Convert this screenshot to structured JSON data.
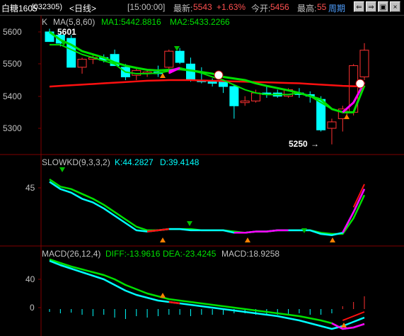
{
  "header": {
    "symbol": "白糖1605",
    "code": "(032305)",
    "period": "<日线>",
    "time": "[15:00:00]",
    "latest_label": "最新:",
    "latest_value": "5543",
    "change": "+1.63%",
    "open_label": "今开:",
    "open_value": "5456",
    "high_label": "最高:",
    "high_value": "55",
    "cycle_label": "周期"
  },
  "colors": {
    "up": "#ff3232",
    "down": "#00ffff",
    "green_line": "#00e000",
    "red_line": "#ff1010",
    "magenta": "#ff00ff",
    "cyan": "#00ffff",
    "text_axis": "#c0c0c0",
    "grid": "#800000"
  },
  "price_panel": {
    "title": "K",
    "ma_label": "MA(5,8,60)",
    "ma1": "MA1:5442.8816",
    "ma2": "MA2:5433.2266",
    "high_marker": "5601",
    "low_marker": "5250",
    "y_ticks": [
      "5600",
      "5500",
      "5400",
      "5300"
    ]
  },
  "kd_panel": {
    "title": "SLOWKD(9,3,3,2)",
    "k": "K:44.2827",
    "d": "D:39.4148",
    "y_ticks": [
      "45"
    ]
  },
  "macd_panel": {
    "title": "MACD(26,12,4)",
    "diff": "DIFF:-13.9616",
    "dea": "DEA:-23.4245",
    "macd": "MACD:18.9258",
    "y_ticks": [
      "40",
      "0"
    ]
  },
  "chart_data": {
    "type": "candlestick",
    "candles": [
      {
        "o": 5600,
        "h": 5610,
        "l": 5570,
        "c": 5570
      },
      {
        "o": 5590,
        "h": 5600,
        "l": 5555,
        "c": 5565
      },
      {
        "o": 5580,
        "h": 5590,
        "l": 5490,
        "c": 5490
      },
      {
        "o": 5490,
        "h": 5520,
        "l": 5470,
        "c": 5515
      },
      {
        "o": 5515,
        "h": 5530,
        "l": 5500,
        "c": 5520
      },
      {
        "o": 5520,
        "h": 5530,
        "l": 5505,
        "c": 5512
      },
      {
        "o": 5530,
        "h": 5545,
        "l": 5495,
        "c": 5495
      },
      {
        "o": 5490,
        "h": 5500,
        "l": 5450,
        "c": 5460
      },
      {
        "o": 5465,
        "h": 5490,
        "l": 5450,
        "c": 5480
      },
      {
        "o": 5470,
        "h": 5485,
        "l": 5460,
        "c": 5475
      },
      {
        "o": 5475,
        "h": 5495,
        "l": 5460,
        "c": 5470
      },
      {
        "o": 5490,
        "h": 5545,
        "l": 5470,
        "c": 5540
      },
      {
        "o": 5540,
        "h": 5550,
        "l": 5500,
        "c": 5505
      },
      {
        "o": 5500,
        "h": 5520,
        "l": 5445,
        "c": 5450
      },
      {
        "o": 5450,
        "h": 5490,
        "l": 5440,
        "c": 5445
      },
      {
        "o": 5445,
        "h": 5455,
        "l": 5430,
        "c": 5440
      },
      {
        "o": 5445,
        "h": 5450,
        "l": 5410,
        "c": 5430
      },
      {
        "o": 5430,
        "h": 5435,
        "l": 5330,
        "c": 5370
      },
      {
        "o": 5380,
        "h": 5400,
        "l": 5370,
        "c": 5385
      },
      {
        "o": 5385,
        "h": 5420,
        "l": 5380,
        "c": 5410
      },
      {
        "o": 5410,
        "h": 5430,
        "l": 5395,
        "c": 5405
      },
      {
        "o": 5410,
        "h": 5420,
        "l": 5395,
        "c": 5400
      },
      {
        "o": 5400,
        "h": 5425,
        "l": 5395,
        "c": 5420
      },
      {
        "o": 5410,
        "h": 5425,
        "l": 5395,
        "c": 5405
      },
      {
        "o": 5405,
        "h": 5415,
        "l": 5380,
        "c": 5400
      },
      {
        "o": 5390,
        "h": 5400,
        "l": 5290,
        "c": 5295
      },
      {
        "o": 5300,
        "h": 5330,
        "l": 5250,
        "c": 5320
      },
      {
        "o": 5330,
        "h": 5370,
        "l": 5290,
        "c": 5360
      },
      {
        "o": 5350,
        "h": 5500,
        "l": 5340,
        "c": 5495
      },
      {
        "o": 5460,
        "h": 5565,
        "l": 5450,
        "c": 5543
      }
    ],
    "ma1": [
      5560,
      5560,
      5545,
      5530,
      5520,
      5510,
      5500,
      5475,
      5470,
      5470,
      5472,
      5478,
      5488,
      5480,
      5472,
      5460,
      5450,
      5435,
      5420,
      5410,
      5405,
      5405,
      5405,
      5410,
      5400,
      5380,
      5360,
      5350,
      5380,
      5443
    ],
    "ma2": [
      5600,
      5575,
      5560,
      5540,
      5530,
      5520,
      5505,
      5495,
      5488,
      5482,
      5480,
      5482,
      5484,
      5480,
      5475,
      5470,
      5460,
      5455,
      5450,
      5440,
      5432,
      5425,
      5418,
      5410,
      5400,
      5390,
      5360,
      5350,
      5350,
      5433
    ],
    "ma3": [
      5430,
      5432,
      5434,
      5436,
      5438,
      5440,
      5442,
      5444,
      5446,
      5448,
      5449,
      5450,
      5450,
      5450,
      5449,
      5448,
      5447,
      5446,
      5445,
      5444,
      5443,
      5442,
      5441,
      5440,
      5438,
      5436,
      5434,
      5432,
      5431,
      5430
    ],
    "kd_k": [
      50,
      44,
      41,
      36,
      33,
      28,
      22,
      16,
      10,
      9,
      10,
      11,
      11,
      10,
      10,
      10,
      10,
      8,
      8,
      9,
      9,
      10,
      10,
      10,
      10,
      7,
      6,
      8,
      25,
      44
    ],
    "kd_d": [
      52,
      46,
      44,
      40,
      36,
      31,
      25,
      19,
      13,
      10,
      10,
      11,
      11,
      11,
      10,
      10,
      10,
      9,
      8,
      9,
      9,
      10,
      10,
      10,
      10,
      8,
      7,
      7,
      20,
      39
    ],
    "macd_diff": [
      66,
      60,
      55,
      50,
      45,
      40,
      32,
      24,
      18,
      14,
      10,
      8,
      6,
      4,
      2,
      0,
      -2,
      -4,
      -6,
      -8,
      -10,
      -12,
      -15,
      -18,
      -22,
      -26,
      -30,
      -26,
      -20,
      -14
    ],
    "macd_dea": [
      68,
      63,
      58,
      54,
      50,
      46,
      40,
      32,
      26,
      20,
      16,
      12,
      10,
      8,
      6,
      4,
      2,
      0,
      -2,
      -4,
      -6,
      -8,
      -10,
      -12,
      -15,
      -18,
      -22,
      -30,
      -28,
      -23
    ],
    "macd_hist": [
      -4,
      -6,
      -5,
      -8,
      -10,
      -8,
      -12,
      -14,
      -10,
      -12,
      -10,
      -8,
      -8,
      -10,
      -8,
      -8,
      -8,
      -6,
      -6,
      -8,
      -8,
      -8,
      -8,
      -6,
      -8,
      -8,
      -6,
      4,
      10,
      18
    ]
  }
}
